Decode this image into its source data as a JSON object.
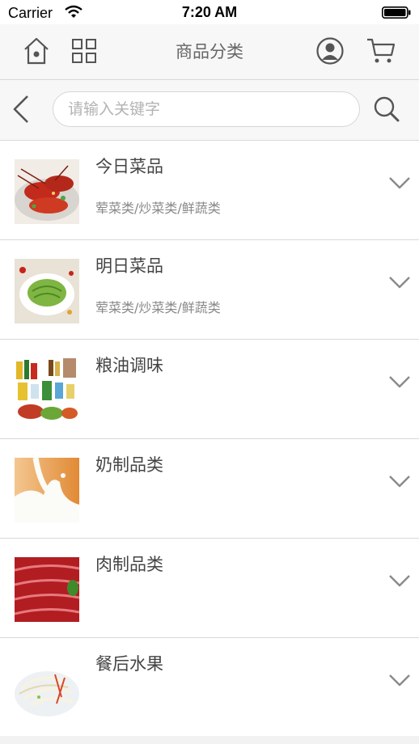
{
  "status_bar": {
    "carrier": "Carrier",
    "time": "7:20 AM"
  },
  "header": {
    "title": "商品分类"
  },
  "search": {
    "placeholder": "请输入关键字",
    "value": ""
  },
  "categories": [
    {
      "name": "今日菜品",
      "subtitle": "荤菜类/炒菜类/鲜蔬类",
      "image": "crayfish-dish"
    },
    {
      "name": "明日菜品",
      "subtitle": "荤菜类/炒菜类/鲜蔬类",
      "image": "green-vegetable-dish"
    },
    {
      "name": "粮油调味",
      "subtitle": "",
      "image": "grain-oil-products"
    },
    {
      "name": "奶制品类",
      "subtitle": "",
      "image": "milk-splash"
    },
    {
      "name": "肉制品类",
      "subtitle": "",
      "image": "raw-meat-slices"
    },
    {
      "name": "餐后水果",
      "subtitle": "",
      "image": "fruit-salad"
    }
  ],
  "colors": {
    "nav_background": "#f7f7f7",
    "divider": "#d8d8d8",
    "icon": "#555555",
    "chevron": "#8a8a8a"
  }
}
